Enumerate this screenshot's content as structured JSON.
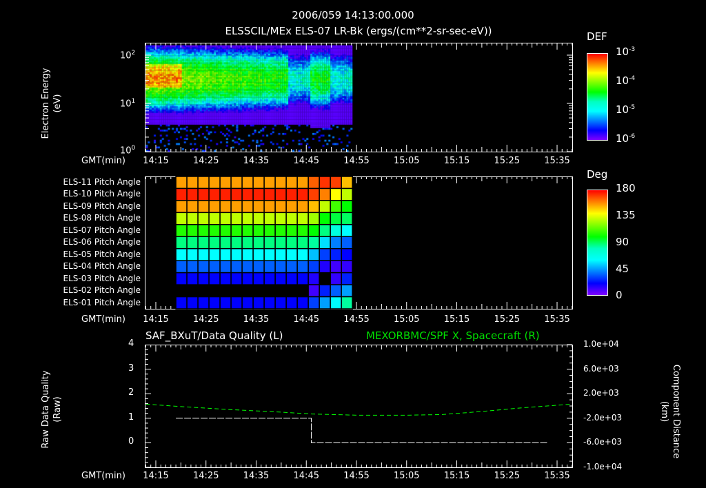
{
  "header": {
    "timestamp": "2006/059 14:13:00.000",
    "title": "ELSSCIL/MEx ELS-07 LR-Bk  (ergs/(cm**2-sr-sec-eV))"
  },
  "time_axis": {
    "label": "GMT(min)",
    "ticks": [
      "14:15",
      "14:25",
      "14:35",
      "14:45",
      "14:55",
      "15:05",
      "15:15",
      "15:25",
      "15:35"
    ],
    "tick_minutes": [
      15,
      25,
      35,
      45,
      55,
      65,
      75,
      85,
      95
    ],
    "range_minutes": [
      12.7,
      98
    ]
  },
  "chart_data": [
    {
      "type": "heatmap",
      "name": "electron-spectrogram",
      "ylabel": "Electron Energy",
      "yunit": "(eV)",
      "yscale": "log",
      "ylim": [
        1,
        180
      ],
      "yticks": [
        {
          "base": "10",
          "exp": "0"
        },
        {
          "base": "10",
          "exp": "1"
        },
        {
          "base": "10",
          "exp": "2"
        }
      ],
      "data_time_range_minutes": [
        13,
        54
      ],
      "peak_energy_eV": 30,
      "low_energy_cutoff_eV": 3.5,
      "colorbar": {
        "title": "DEF",
        "scale": "log",
        "range_log10": [
          -6,
          -3
        ],
        "ticks": [
          {
            "base": "10",
            "exp": "-3"
          },
          {
            "base": "10",
            "exp": "-4"
          },
          {
            "base": "10",
            "exp": "-5"
          },
          {
            "base": "10",
            "exp": "-6"
          }
        ]
      }
    },
    {
      "type": "heatmap",
      "name": "pitch-angle",
      "rows": [
        "ELS-11 Pitch Angle",
        "ELS-10 Pitch Angle",
        "ELS-09 Pitch Angle",
        "ELS-08 Pitch Angle",
        "ELS-07 Pitch Angle",
        "ELS-06 Pitch Angle",
        "ELS-05 Pitch Angle",
        "ELS-04 Pitch Angle",
        "ELS-03 Pitch Angle",
        "ELS-02 Pitch Angle",
        "ELS-01 Pitch Angle"
      ],
      "column_start_minutes": 19,
      "column_width_minutes": 2.2,
      "values_deg": [
        [
          155,
          155,
          155,
          155,
          155,
          155,
          155,
          155,
          155,
          155,
          155,
          155,
          165,
          172,
          170,
          150
        ],
        [
          175,
          175,
          175,
          175,
          175,
          175,
          175,
          175,
          175,
          175,
          175,
          175,
          170,
          160,
          140,
          130
        ],
        [
          155,
          155,
          155,
          155,
          155,
          155,
          155,
          155,
          155,
          155,
          155,
          155,
          150,
          130,
          110,
          100
        ],
        [
          130,
          130,
          130,
          130,
          130,
          130,
          130,
          130,
          130,
          130,
          130,
          130,
          125,
          100,
          90,
          85
        ],
        [
          105,
          105,
          105,
          105,
          105,
          105,
          105,
          105,
          105,
          105,
          105,
          105,
          100,
          80,
          65,
          60
        ],
        [
          80,
          80,
          80,
          80,
          80,
          80,
          80,
          80,
          80,
          80,
          80,
          80,
          75,
          55,
          40,
          35
        ],
        [
          60,
          60,
          60,
          60,
          60,
          60,
          60,
          60,
          60,
          60,
          60,
          60,
          50,
          30,
          25,
          20
        ],
        [
          35,
          35,
          35,
          35,
          35,
          35,
          35,
          35,
          35,
          35,
          35,
          35,
          30,
          15,
          10,
          12
        ],
        [
          20,
          20,
          20,
          20,
          20,
          20,
          20,
          20,
          20,
          20,
          20,
          20,
          15,
          null,
          12,
          25
        ],
        [
          null,
          null,
          null,
          null,
          null,
          null,
          null,
          null,
          null,
          null,
          null,
          null,
          10,
          25,
          35,
          45
        ],
        [
          20,
          20,
          20,
          20,
          20,
          20,
          20,
          20,
          20,
          20,
          20,
          20,
          30,
          45,
          60,
          75
        ]
      ],
      "colorbar": {
        "title": "Deg",
        "range": [
          0,
          180
        ],
        "ticks": [
          "180",
          "135",
          "90",
          "45",
          "0"
        ]
      }
    },
    {
      "type": "line",
      "name": "data-quality-and-position",
      "left_title": "SAF_BXuT/Data Quality (L)",
      "right_title": "MEXORBMC/SPF X, Spacecraft (R)",
      "ylabel_left": "Raw Data Quality",
      "yunit_left": "(Raw)",
      "ylabel_right": "Component Distance",
      "yunit_right": "(km)",
      "ylim_left": [
        -1,
        4
      ],
      "yticks_left": [
        "4",
        "3",
        "2",
        "1",
        "0"
      ],
      "ylim_right": [
        -10000,
        10000
      ],
      "yticks_right": [
        "1.0e+04",
        "6.0e+03",
        "2.0e+03",
        "-2.0e+03",
        "-6.0e+03",
        "-1.0e+04"
      ],
      "series": [
        {
          "name": "Data Quality",
          "color": "#ffffff",
          "x_minutes": [
            19,
            46,
            46,
            93
          ],
          "y": [
            1,
            1,
            0,
            0
          ]
        },
        {
          "name": "SPF X",
          "color": "#00ff00",
          "x_minutes": [
            13,
            20,
            30,
            40,
            46,
            55,
            65,
            72,
            80,
            88,
            98
          ],
          "y": [
            300,
            -100,
            -600,
            -1000,
            -1300,
            -1500,
            -1500,
            -1400,
            -900,
            -300,
            300
          ]
        }
      ]
    }
  ]
}
